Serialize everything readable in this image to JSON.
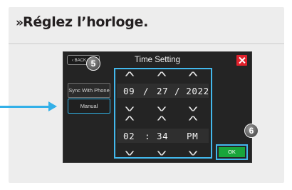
{
  "instruction": {
    "chevron": "»",
    "text": "Réglez l’horloge."
  },
  "screen": {
    "title": "Time Setting",
    "back_label": "BACK",
    "sync_label": "Sync With Phone",
    "manual_label": "Manual",
    "ok_label": "OK"
  },
  "date": {
    "month": "09",
    "sep1": "/",
    "day": "27",
    "year": "/ 2022"
  },
  "time": {
    "hour": "02",
    "sep": ":",
    "minute": "34",
    "ampm": "PM"
  },
  "arrows": {
    "up": "^",
    "down": "v"
  },
  "badges": {
    "step_back": "5",
    "step_ok": "6"
  },
  "colors": {
    "highlight": "#43b8ec",
    "close": "#e0212c",
    "ok": "#19a53b"
  }
}
